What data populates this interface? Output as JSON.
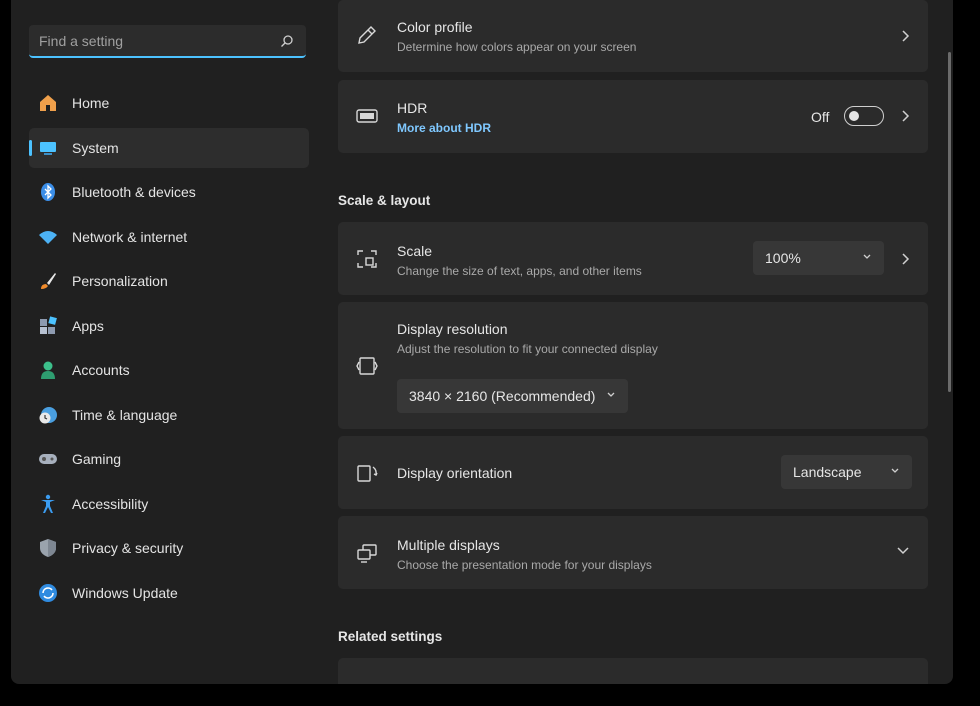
{
  "search": {
    "placeholder": "Find a setting"
  },
  "sidebar": {
    "items": [
      {
        "label": "Home",
        "icon": "home-icon"
      },
      {
        "label": "System",
        "icon": "system-icon",
        "active": true
      },
      {
        "label": "Bluetooth & devices",
        "icon": "bluetooth-icon"
      },
      {
        "label": "Network & internet",
        "icon": "wifi-icon"
      },
      {
        "label": "Personalization",
        "icon": "brush-icon"
      },
      {
        "label": "Apps",
        "icon": "apps-icon"
      },
      {
        "label": "Accounts",
        "icon": "accounts-icon"
      },
      {
        "label": "Time & language",
        "icon": "clock-globe-icon"
      },
      {
        "label": "Gaming",
        "icon": "gamepad-icon"
      },
      {
        "label": "Accessibility",
        "icon": "accessibility-icon"
      },
      {
        "label": "Privacy & security",
        "icon": "shield-icon"
      },
      {
        "label": "Windows Update",
        "icon": "update-icon"
      }
    ]
  },
  "main": {
    "color_profile": {
      "title": "Color profile",
      "subtitle": "Determine how colors appear on your screen"
    },
    "hdr": {
      "title": "HDR",
      "link": "More about HDR",
      "state_label": "Off",
      "on": false
    },
    "scale_layout_heading": "Scale & layout",
    "scale": {
      "title": "Scale",
      "subtitle": "Change the size of text, apps, and other items",
      "value": "100%"
    },
    "resolution": {
      "title": "Display resolution",
      "subtitle": "Adjust the resolution to fit your connected display",
      "value": "3840 × 2160 (Recommended)"
    },
    "orientation": {
      "title": "Display orientation",
      "value": "Landscape"
    },
    "multiple": {
      "title": "Multiple displays",
      "subtitle": "Choose the presentation mode for your displays"
    },
    "related_heading": "Related settings"
  },
  "colors": {
    "accent": "#4cc2ff",
    "background": "#202020",
    "card": "#2b2b2b"
  }
}
